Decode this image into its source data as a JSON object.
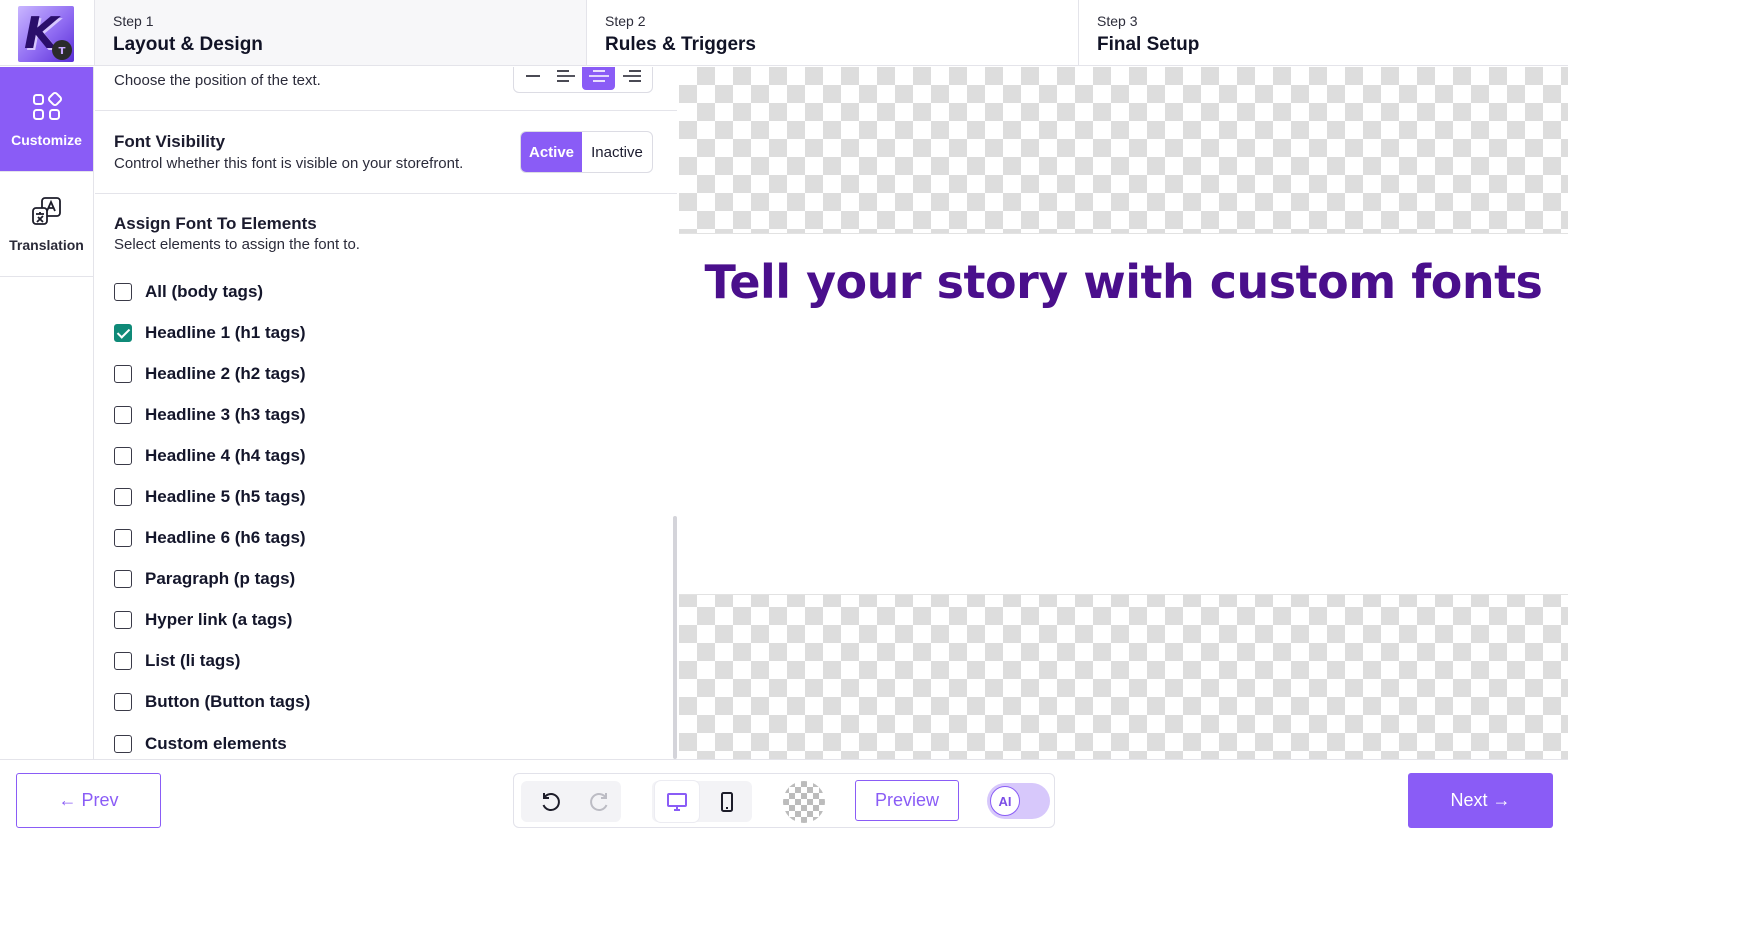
{
  "steps": [
    {
      "num": "Step 1",
      "title": "Layout & Design"
    },
    {
      "num": "Step 2",
      "title": "Rules & Triggers"
    },
    {
      "num": "Step 3",
      "title": "Final Setup"
    }
  ],
  "active_step_index": 0,
  "logo": {
    "letter": "K"
  },
  "rail": {
    "items": [
      {
        "label": "Customize",
        "icon": "apps-grid-icon",
        "active": true
      },
      {
        "label": "Translation",
        "icon": "translate-icon",
        "active": false
      }
    ]
  },
  "panel": {
    "alignment": {
      "description": "Choose the position of the text.",
      "options": [
        "none",
        "left",
        "center",
        "right"
      ],
      "selected": "center"
    },
    "visibility": {
      "title": "Font Visibility",
      "description": "Control whether this font is visible on your storefront.",
      "active_label": "Active",
      "inactive_label": "Inactive",
      "selected": "Active"
    },
    "assign": {
      "title": "Assign Font To Elements",
      "description": "Select elements to assign the font to.",
      "items": [
        {
          "label": "All (body tags)",
          "checked": false
        },
        {
          "label": "Headline 1 (h1 tags)",
          "checked": true
        },
        {
          "label": "Headline 2 (h2 tags)",
          "checked": false
        },
        {
          "label": "Headline 3 (h3 tags)",
          "checked": false
        },
        {
          "label": "Headline 4 (h4 tags)",
          "checked": false
        },
        {
          "label": "Headline 5 (h5 tags)",
          "checked": false
        },
        {
          "label": "Headline 6 (h6 tags)",
          "checked": false
        },
        {
          "label": "Paragraph (p tags)",
          "checked": false
        },
        {
          "label": "Hyper link (a tags)",
          "checked": false
        },
        {
          "label": "List (li tags)",
          "checked": false
        },
        {
          "label": "Button (Button tags)",
          "checked": false
        },
        {
          "label": "Custom elements",
          "checked": false
        }
      ]
    }
  },
  "preview": {
    "headline": "Tell your story with custom fonts",
    "headline_color": "#4a0f8c"
  },
  "bottom": {
    "prev_label": "← Prev",
    "next_label": "Next →",
    "preview_label": "Preview",
    "ai_label": "AI",
    "ai_enabled": false,
    "device_selected": "desktop"
  },
  "colors": {
    "accent": "#8a5cf6",
    "checkbox_checked": "#0f8a78"
  }
}
